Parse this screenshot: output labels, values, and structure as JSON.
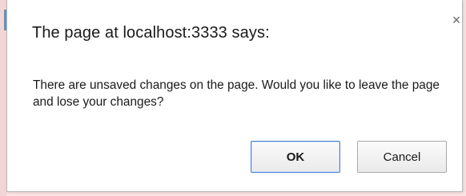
{
  "dialog": {
    "title": "The page at localhost:3333 says:",
    "close_glyph": "×",
    "message": "There are unsaved changes on the page. Would you like to leave the page and lose your changes?",
    "ok_label": "OK",
    "cancel_label": "Cancel"
  },
  "colors": {
    "backdrop": "#fbe3e3",
    "dialog_bg": "#ffffff",
    "ok_border": "#4a7ed1",
    "text": "#1a1a1a"
  },
  "icons": {
    "close": "close-icon"
  }
}
